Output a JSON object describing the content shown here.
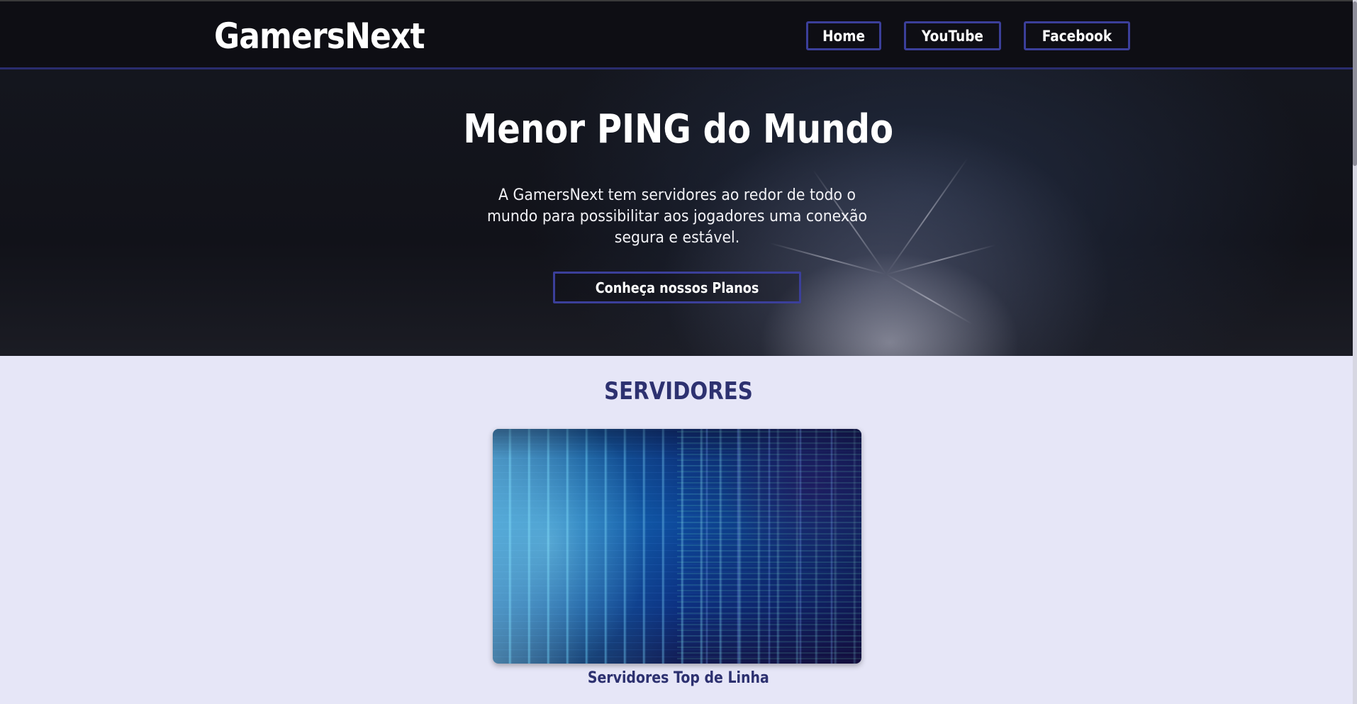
{
  "header": {
    "logo": "GamersNext",
    "nav": [
      {
        "label": "Home"
      },
      {
        "label": "YouTube"
      },
      {
        "label": "Facebook"
      }
    ]
  },
  "hero": {
    "title": "Menor PING do Mundo",
    "text": "A GamersNext tem servidores ao redor de todo o mundo para possibilitar aos jogadores uma conexão segura e estável.",
    "cta_label": "Conheça nossos Planos"
  },
  "servers": {
    "title": "SERVIDORES",
    "card": {
      "image_icon": "server-rack-image",
      "caption": "Servidores Top de Linha"
    }
  },
  "colors": {
    "accent": "#3b3f9a",
    "heading": "#2d3170",
    "section_bg": "#e6e6f7",
    "header_bg": "#0e0e14"
  }
}
